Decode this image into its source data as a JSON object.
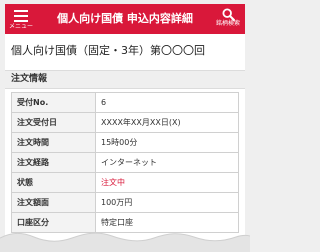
{
  "header": {
    "menu_label": "メニュー",
    "title": "個人向け国債 申込内容詳細",
    "search_label": "銘柄検索"
  },
  "page": {
    "heading": "個人向け国債（固定・3年）第〇〇〇回"
  },
  "section": {
    "title": "注文情報"
  },
  "order_rows": [
    {
      "label": "受付No.",
      "value": "6"
    },
    {
      "label": "注文受付日",
      "value": "XXXX年XX月XX日(X)"
    },
    {
      "label": "注文時間",
      "value": "15時00分"
    },
    {
      "label": "注文経路",
      "value": "インターネット"
    },
    {
      "label": "状態",
      "value": "注文中"
    },
    {
      "label": "注文額面",
      "value": "100万円"
    },
    {
      "label": "口座区分",
      "value": "特定口座"
    }
  ],
  "colors": {
    "brand": "#d9183a",
    "status": "#d9183a"
  }
}
